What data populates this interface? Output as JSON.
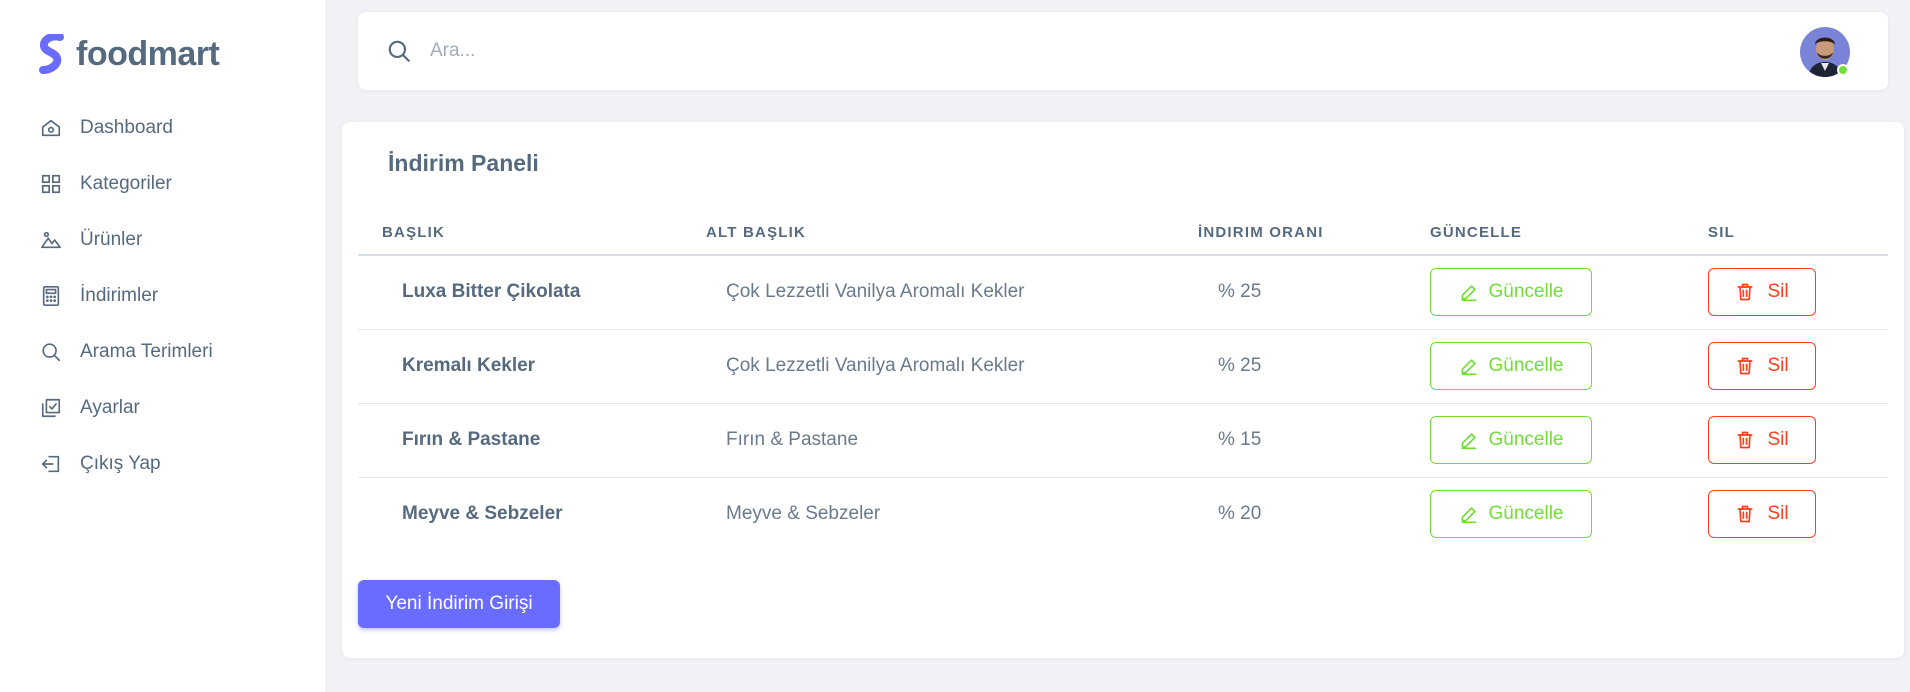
{
  "brand": {
    "name": "foodmart",
    "accent": "#696cff"
  },
  "sidebar": {
    "items": [
      {
        "label": "Dashboard",
        "icon": "home-icon"
      },
      {
        "label": "Kategoriler",
        "icon": "grid-icon"
      },
      {
        "label": "Ürünler",
        "icon": "image-icon"
      },
      {
        "label": "İndirimler",
        "icon": "calculator-icon"
      },
      {
        "label": "Arama Terimleri",
        "icon": "search-icon"
      },
      {
        "label": "Ayarlar",
        "icon": "checkbox-icon"
      },
      {
        "label": "Çıkış Yap",
        "icon": "logout-icon"
      }
    ]
  },
  "search": {
    "placeholder": "Ara..."
  },
  "user": {
    "status": "online",
    "status_color": "#71dd37"
  },
  "panel": {
    "title": "İndirim Paneli",
    "columns": [
      "BAŞLIK",
      "ALT BAŞLIK",
      "İNDIRIM ORANI",
      "GÜNCELLE",
      "SIL"
    ],
    "rows": [
      {
        "title": "Luxa Bitter Çikolata",
        "subtitle": "Çok Lezzetli Vanilya Aromalı Kekler",
        "rate": "% 25"
      },
      {
        "title": "Kremalı Kekler",
        "subtitle": "Çok Lezzetli Vanilya Aromalı Kekler",
        "rate": "% 25"
      },
      {
        "title": "Fırın & Pastane",
        "subtitle": "Fırın & Pastane",
        "rate": "% 15"
      },
      {
        "title": "Meyve & Sebzeler",
        "subtitle": "Meyve & Sebzeler",
        "rate": "% 20"
      }
    ],
    "update_label": "Güncelle",
    "delete_label": "Sil",
    "new_button_label": "Yeni İndirim Girişi"
  },
  "colors": {
    "success": "#71dd37",
    "danger": "#ff3e1d",
    "primary": "#696cff",
    "text": "#566a7f"
  }
}
